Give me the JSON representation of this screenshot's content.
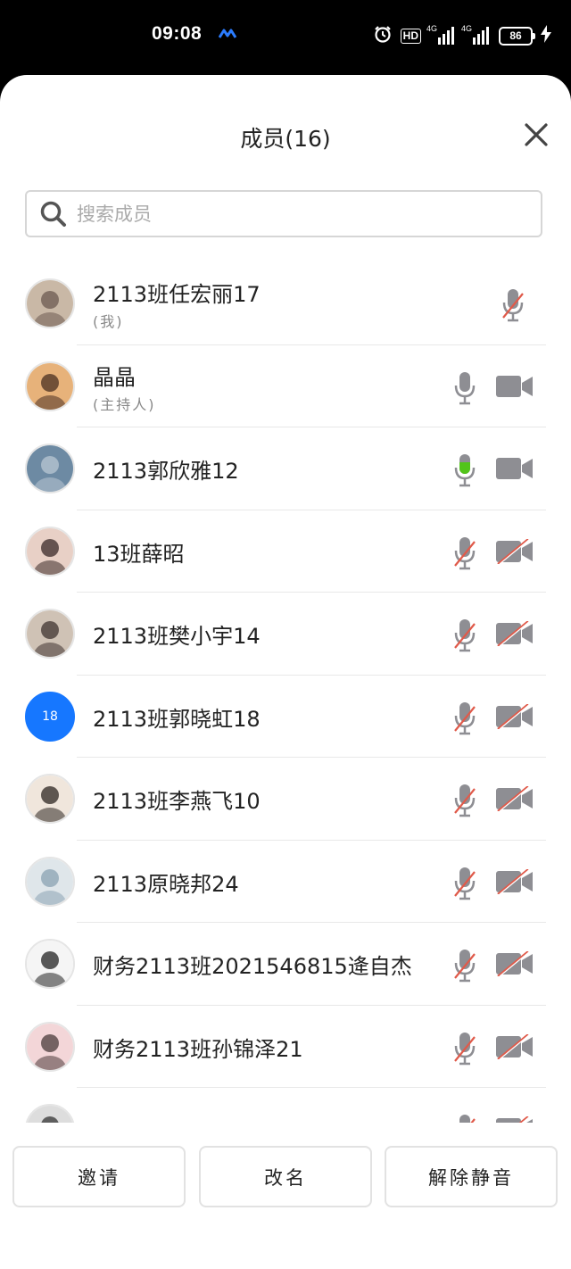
{
  "status_bar": {
    "time": "09:08",
    "battery": "86",
    "hd_label": "HD",
    "signal_label": "4G"
  },
  "title": "成员(16)",
  "search": {
    "placeholder": "搜索成员"
  },
  "colors": {
    "accent": "#1677ff",
    "mic_active": "#52c41a",
    "muted_slash": "#e05a4a",
    "icon_gray": "#8e8e93"
  },
  "members": [
    {
      "name": "2113班任宏丽17",
      "sub": "(我)",
      "mic": "muted",
      "cam": "none",
      "avatar": "photo"
    },
    {
      "name": "晶晶",
      "sub": "(主持人)",
      "mic": "on",
      "cam": "on",
      "avatar": "photo"
    },
    {
      "name": "2113郭欣雅12",
      "mic": "speaking",
      "cam": "on",
      "avatar": "photo"
    },
    {
      "name": "13班薛昭",
      "mic": "muted",
      "cam": "off",
      "avatar": "photo"
    },
    {
      "name": "2113班樊小宇14",
      "mic": "muted",
      "cam": "off",
      "avatar": "photo"
    },
    {
      "name": "2113班郭晓虹18",
      "mic": "muted",
      "cam": "off",
      "avatar": "initials",
      "initials": "18"
    },
    {
      "name": "2113班李燕飞10",
      "mic": "muted",
      "cam": "off",
      "avatar": "photo"
    },
    {
      "name": "2113原晓邦24",
      "mic": "muted",
      "cam": "off",
      "avatar": "photo"
    },
    {
      "name": "财务2113班2021546815逄自杰",
      "mic": "muted",
      "cam": "off",
      "avatar": "photo"
    },
    {
      "name": "财务2113班孙锦泽21",
      "mic": "muted",
      "cam": "off",
      "avatar": "photo"
    },
    {
      "name": "",
      "mic": "muted",
      "cam": "off",
      "avatar": "photo"
    }
  ],
  "footer": {
    "invite": "邀请",
    "rename": "改名",
    "unmute": "解除静音"
  }
}
